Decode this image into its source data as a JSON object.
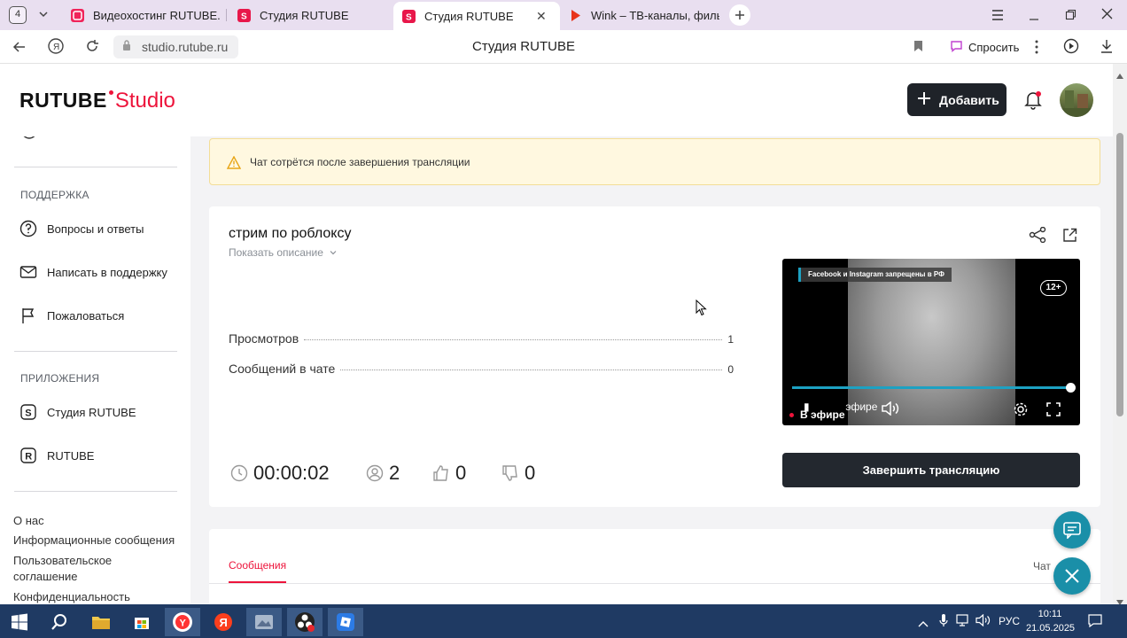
{
  "browser": {
    "tab_count": "4",
    "tabs": [
      {
        "title": "Видеохостинг RUTUBE. С"
      },
      {
        "title": "Студия RUTUBE"
      },
      {
        "title": "Студия RUTUBE"
      },
      {
        "title": "Wink – ТВ-каналы, фильм"
      }
    ],
    "url": "studio.rutube.ru",
    "page_title": "Студия RUTUBE",
    "ask_label": "Спросить"
  },
  "header": {
    "logo_main": "RUTUBE",
    "logo_sub": "Studio",
    "add_label": "Добавить"
  },
  "sidebar": {
    "support_title": "ПОДДЕРЖКА",
    "support_items": [
      {
        "label": "Вопросы и ответы"
      },
      {
        "label": "Написать в поддержку"
      },
      {
        "label": "Пожаловаться"
      }
    ],
    "apps_title": "ПРИЛОЖЕНИЯ",
    "app_items": [
      {
        "label": "Студия RUTUBE"
      },
      {
        "label": "RUTUBE"
      }
    ],
    "footer_links": [
      {
        "label": "О нас"
      },
      {
        "label": "Информационные сообщения"
      },
      {
        "label": "Пользовательское соглашение"
      },
      {
        "label": "Конфиденциальность"
      }
    ]
  },
  "notice": {
    "text": "Чат сотрётся после завершения трансляции"
  },
  "stream": {
    "title": "стрим по роблоксу",
    "show_description": "Показать описание",
    "views_label": "Просмотров",
    "views_value": "1",
    "messages_label": "Сообщений в чате",
    "messages_value": "0",
    "duration": "00:00:02",
    "viewers": "2",
    "likes": "0",
    "dislikes": "0",
    "end_button": "Завершить трансляцию"
  },
  "player": {
    "banner": "Facebook и Instagram запрещены в РФ",
    "age_badge": "12+",
    "live_label": "В эфире",
    "live_label_behind": "эфире",
    "progress": 1.0
  },
  "chat": {
    "tab_messages": "Сообщения",
    "tab_chat": "Чат"
  },
  "taskbar": {
    "lang": "РУС",
    "time": "10:11",
    "date": "21.05.2025"
  },
  "colors": {
    "accent_red": "#ed143b",
    "player_progress": "#1da1c2",
    "float_button": "#1a8fa8"
  }
}
